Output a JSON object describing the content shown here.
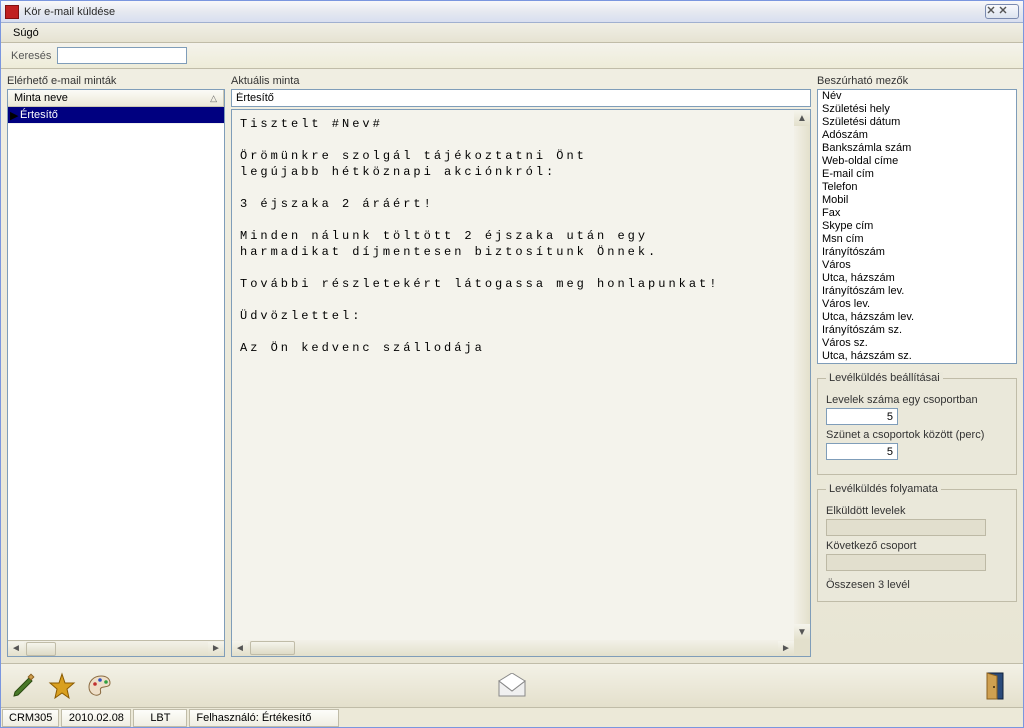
{
  "window": {
    "title": "Kör e-mail küldése",
    "close": "✕✕"
  },
  "menu": {
    "help": "Súgó"
  },
  "search": {
    "label": "Keresés",
    "value": ""
  },
  "templates": {
    "title": "Elérhető e-mail minták",
    "column": "Minta neve",
    "items": [
      {
        "name": "Értesítő",
        "selected": true
      }
    ]
  },
  "current": {
    "title": "Aktuális minta",
    "subject": "Értesítő",
    "body": "Tisztelt #Nev#\n\nÖrömünkre szolgál tájékoztatni Önt\nlegújabb hétköznapi akciónkról:\n\n3 éjszaka 2 áráért!\n\nMinden nálunk töltött 2 éjszaka után egy\nharmadikat díjmentesen biztosítunk Önnek.\n\nTovábbi részletekért látogassa meg honlapunkat!\n\nÜdvözlettel:\n\nAz Ön kedvenc szállodája"
  },
  "fields": {
    "title": "Beszúrható mezők",
    "items": [
      "Név",
      "Születési hely",
      "Születési dátum",
      "Adószám",
      "Bankszámla szám",
      "Web-oldal címe",
      "E-mail cím",
      "Telefon",
      "Mobil",
      "Fax",
      "Skype cím",
      "Msn cím",
      "Irányítószám",
      "Város",
      "Utca, házszám",
      "Irányítószám lev.",
      "Város lev.",
      "Utca, házszám lev.",
      "Irányítószám sz.",
      "Város sz.",
      "Utca, házszám sz."
    ]
  },
  "settings": {
    "title": "Levélküldés beállításai",
    "group_count_label": "Levelek száma egy csoportban",
    "group_count": "5",
    "pause_label": "Szünet a csoportok között (perc)",
    "pause": "5"
  },
  "progress": {
    "title": "Levélküldés folyamata",
    "sent_label": "Elküldött levelek",
    "sent_value": "",
    "next_label": "Következő csoport",
    "next_value": "",
    "total": "Összesen 3 levél"
  },
  "status": {
    "code": "CRM305",
    "date": "2010.02.08",
    "user_short": "LBT",
    "user_long": "Felhasználó: Értékesítő"
  }
}
